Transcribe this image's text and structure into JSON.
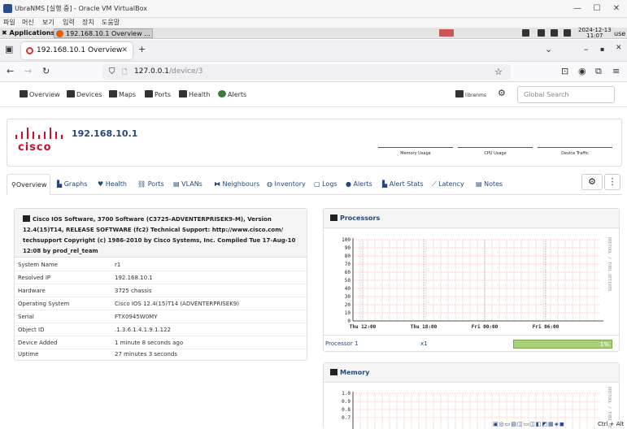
{
  "vbox": {
    "title": "UbraNMS [실행 중] - Oracle VM VirtualBox",
    "menu": [
      "파일",
      "머신",
      "보기",
      "입력",
      "장치",
      "도움말"
    ]
  },
  "panel": {
    "applications": "Applications",
    "task_label": "192.168.10.1 Overview ...",
    "clock_date": "2024-12-13",
    "clock_time": "11:07",
    "user": "use"
  },
  "firefox": {
    "tab_title": "192.168.10.1 Overview",
    "url_host": "127.0.0.1",
    "url_path": "/device/3"
  },
  "nav": {
    "overview": "Overview",
    "devices": "Devices",
    "maps": "Maps",
    "ports": "Ports",
    "health": "Health",
    "alerts": "Alerts",
    "user": "librenms",
    "search_placeholder": "Global Search"
  },
  "device": {
    "hostname": "192.168.10.1",
    "vendor_logo": "cisco",
    "mini_graphs": [
      "Memory Usage",
      "CPU Usage",
      "Device Traffic"
    ]
  },
  "subtabs": [
    "Overview",
    "Graphs",
    "Health",
    "Ports",
    "VLANs",
    "Neighbours",
    "Inventory",
    "Logs",
    "Alerts",
    "Alert Stats",
    "Latency",
    "Notes"
  ],
  "overview": {
    "description_lines": [
      "Cisco IOS Software, 3700 Software (C3725-ADVENTERPRISEK9-M), Version",
      "12.4(15)T14, RELEASE SOFTWARE (fc2) Technical Support: http://www.cisco.com/",
      "techsupport Copyright (c) 1986-2010 by Cisco Systems, Inc. Compiled Tue 17-Aug-10",
      "12:08 by prod_rel_team"
    ],
    "rows": [
      {
        "k": "System Name",
        "v": "r1"
      },
      {
        "k": "Resolved IP",
        "v": "192.168.10.1"
      },
      {
        "k": "Hardware",
        "v": "3725 chassis"
      },
      {
        "k": "Operating System",
        "v": "Cisco IOS 12.4(15)T14 (ADVENTERPRISEK9)"
      },
      {
        "k": "Serial",
        "v": "FTX0945W0MY"
      },
      {
        "k": "Object ID",
        "v": ".1.3.6.1.4.1.9.1.122"
      },
      {
        "k": "Device Added",
        "v": "1 minute 8 seconds ago"
      },
      {
        "k": "Uptime",
        "v": "27 minutes 3 seconds"
      }
    ]
  },
  "processors": {
    "title": "Processors",
    "y_ticks": [
      "100",
      "90",
      "80",
      "70",
      "60",
      "50",
      "40",
      "30",
      "20",
      "10",
      "0"
    ],
    "x_ticks": [
      "Thu 12:00",
      "Thu 18:00",
      "Fri 00:00",
      "Fri 06:00"
    ],
    "watermark": "RRDTOOL / TOBI OETIKER",
    "row_name": "Processor 1",
    "row_count": "x1",
    "usage_percent": 1,
    "usage_label": "1%"
  },
  "memory": {
    "title": "Memory",
    "y_ticks": [
      "1.0",
      "0.9",
      "0.8",
      "0.7"
    ],
    "watermark": "RRDTOOL / TOBI OETIKER"
  },
  "statusbar": {
    "hostkey": "Ctrl + Alt"
  },
  "colors": {
    "link": "#25477a",
    "cisco_red": "#c8102e",
    "grid_red": "#f2b8b8",
    "usage_bar": "#a9cf7b"
  }
}
